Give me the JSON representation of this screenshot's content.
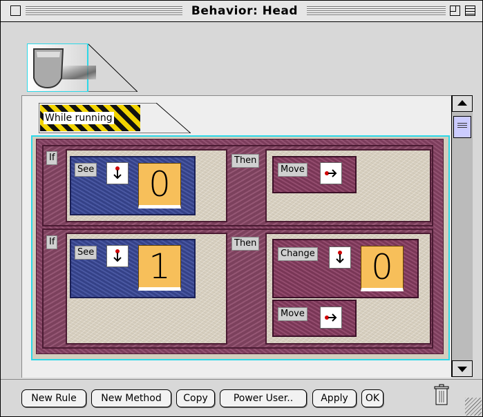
{
  "window": {
    "title": "Behavior: Head"
  },
  "icons": {
    "close": "close-box",
    "zoom": "zoom-box",
    "collapse": "collapse-box",
    "head": "head-piece-icon",
    "direction_down": "arrow-down-icon",
    "direction_right": "arrow-right-icon",
    "trash": "trash-icon"
  },
  "method": {
    "label": "While running"
  },
  "rules": [
    {
      "if_label": "If",
      "then_label": "Then",
      "condition": {
        "label": "See",
        "direction": "down",
        "value": "0"
      },
      "actions": [
        {
          "label": "Move",
          "direction": "right"
        }
      ]
    },
    {
      "if_label": "If",
      "then_label": "Then",
      "condition": {
        "label": "See",
        "direction": "down",
        "value": "1"
      },
      "actions": [
        {
          "label": "Change",
          "direction": "down",
          "value": "0"
        },
        {
          "label": "Move",
          "direction": "right"
        }
      ]
    }
  ],
  "buttons": {
    "new_rule": "New Rule",
    "new_method": "New Method",
    "copy": "Copy",
    "power_user": "Power User..",
    "apply": "Apply",
    "ok": "OK"
  },
  "colors": {
    "method_border": "#2bd8e8",
    "condition_box": "#3b4a9a",
    "action_box": "#8a3d62",
    "value_tile": "#f7bf5a",
    "hazard_yellow": "#f2d400"
  }
}
